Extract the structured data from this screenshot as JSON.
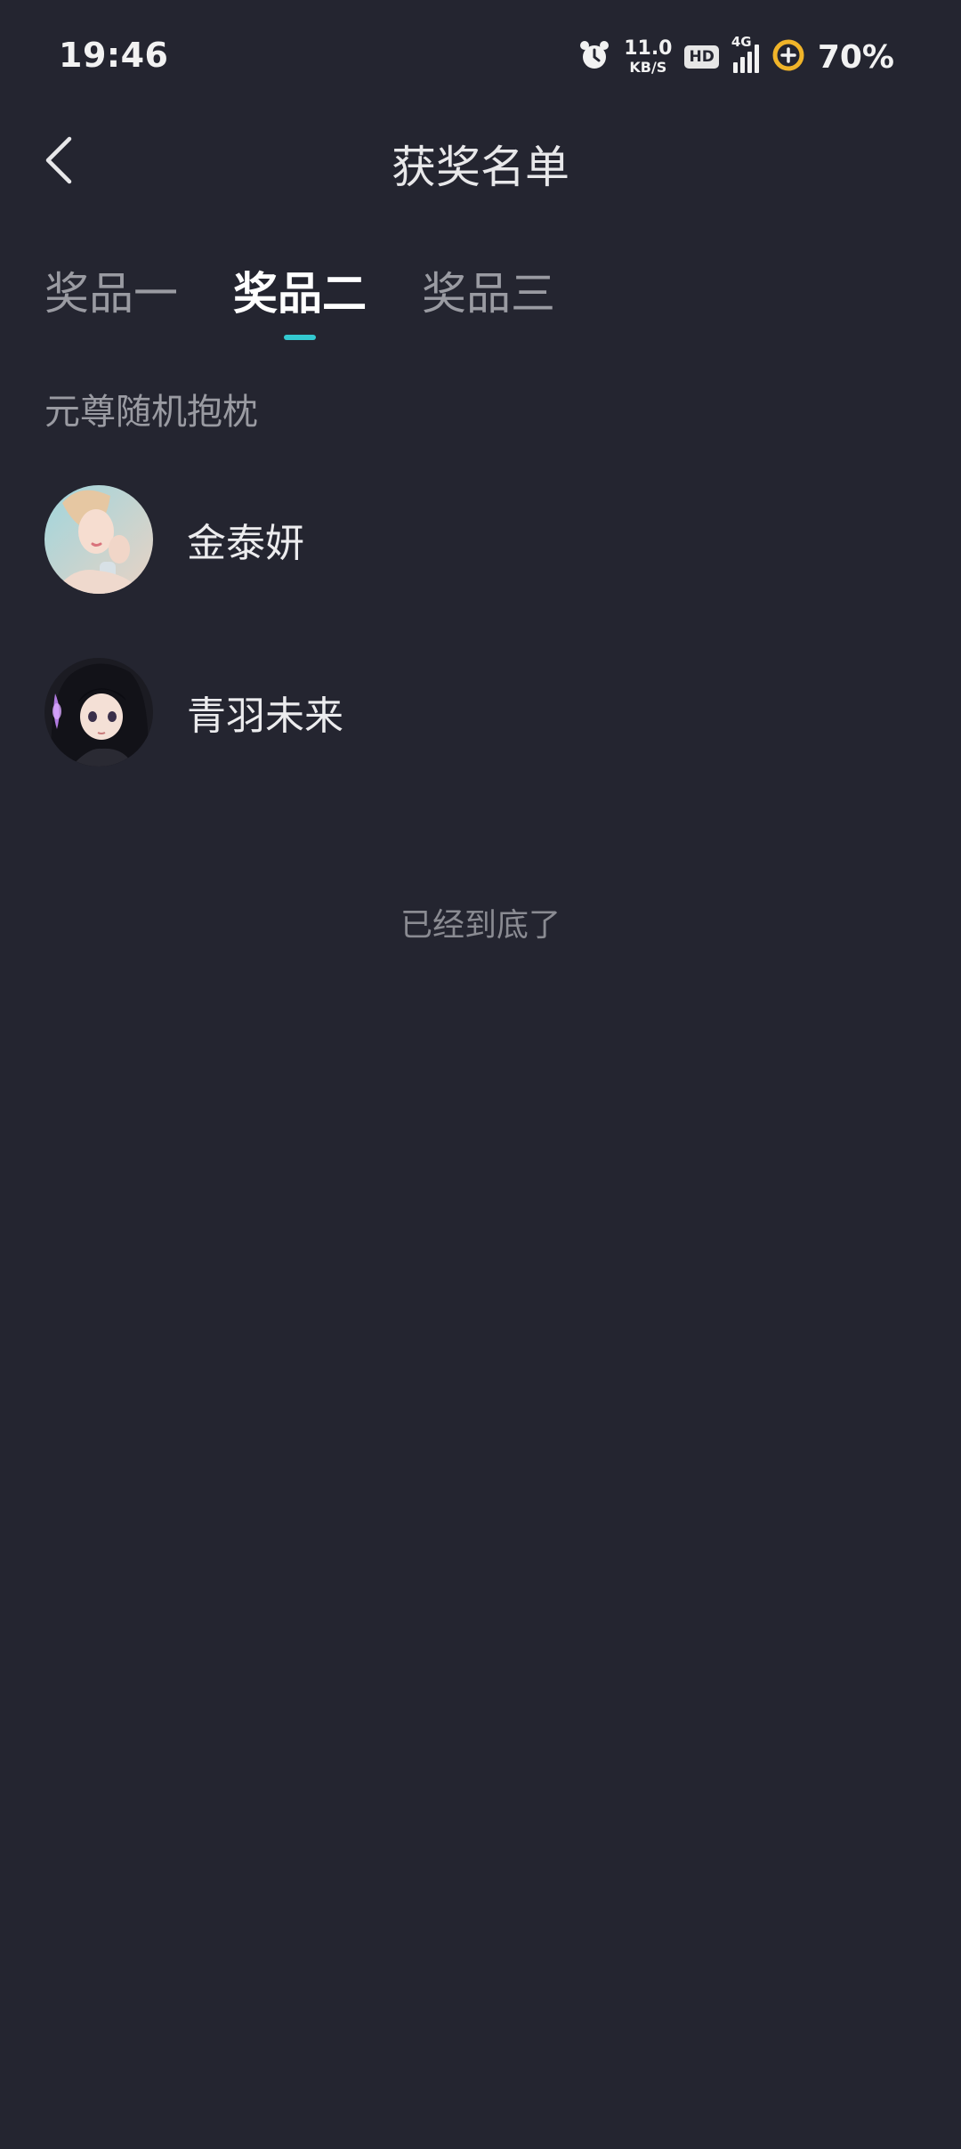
{
  "status_bar": {
    "time": "19:46",
    "net_speed_value": "11.0",
    "net_speed_unit": "KB/S",
    "hd_label": "HD",
    "network_type": "4G",
    "battery": "70%",
    "icons": [
      "alarm-icon",
      "hd-icon",
      "signal-icon",
      "battery-icon"
    ]
  },
  "header": {
    "title": "获奖名单",
    "back_icon": "chevron-left-icon"
  },
  "tabs": [
    {
      "label": "奖品一",
      "active": false
    },
    {
      "label": "奖品二",
      "active": true
    },
    {
      "label": "奖品三",
      "active": false
    }
  ],
  "section": {
    "title": "元尊随机抱枕"
  },
  "winners": [
    {
      "name": "金泰妍"
    },
    {
      "name": "青羽未来"
    }
  ],
  "end_hint": "已经到底了",
  "colors": {
    "background": "#242530",
    "accent": "#33c9d0",
    "battery_ring": "#f0b429"
  }
}
